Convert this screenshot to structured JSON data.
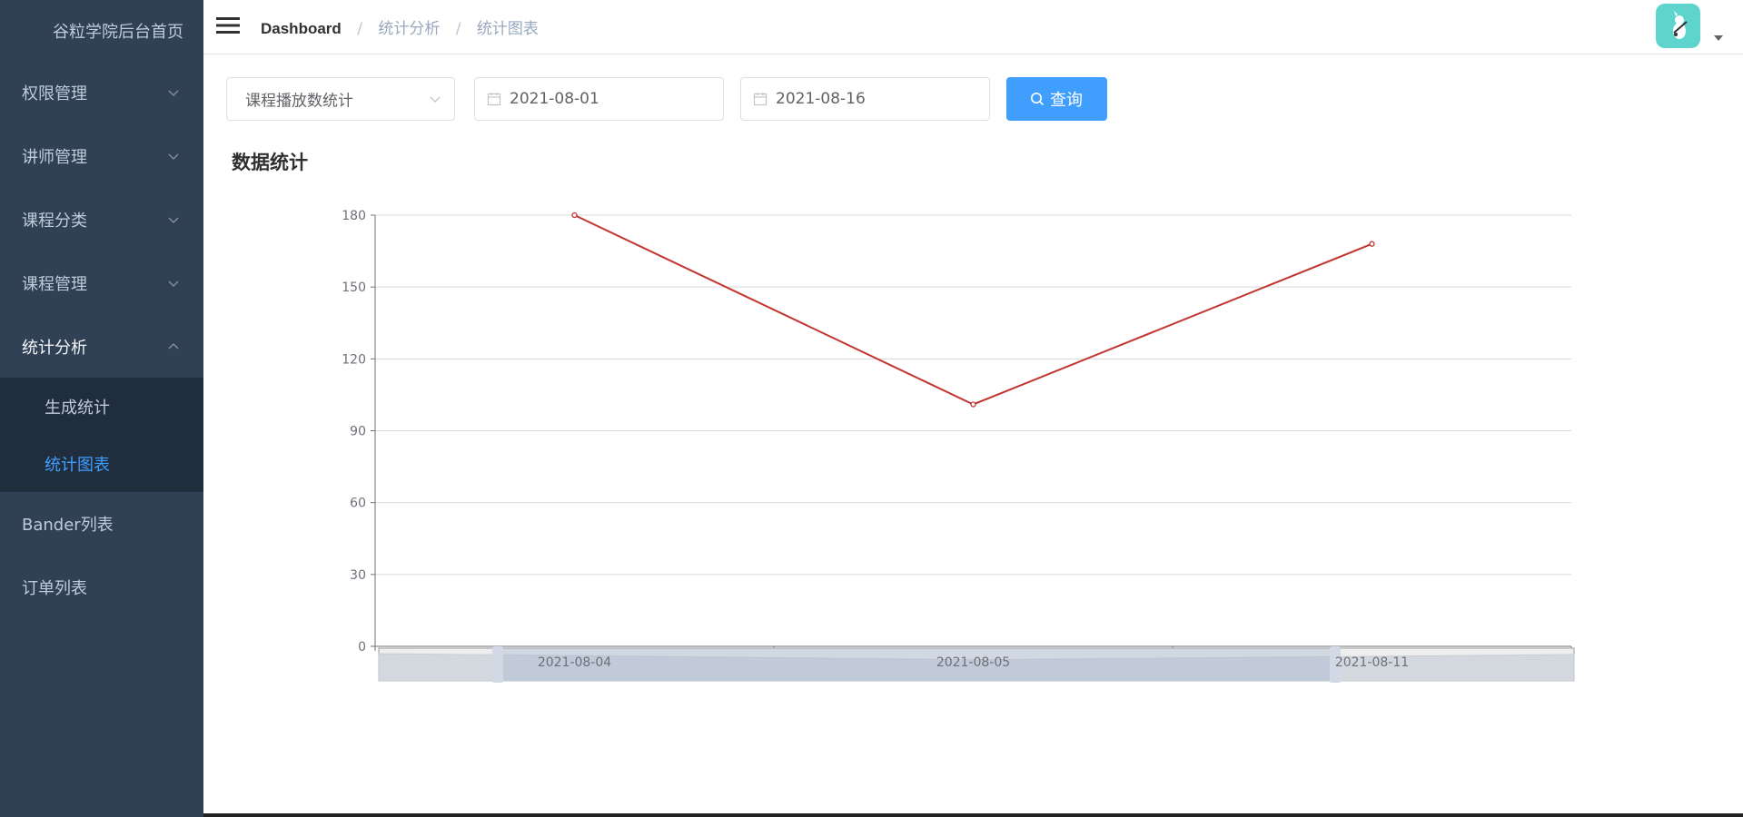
{
  "sidebar": {
    "title": "谷粒学院后台首页",
    "menu": [
      {
        "label": "权限管理"
      },
      {
        "label": "讲师管理"
      },
      {
        "label": "课程分类"
      },
      {
        "label": "课程管理"
      },
      {
        "label": "统计分析"
      }
    ],
    "submenu": [
      {
        "label": "生成统计"
      },
      {
        "label": "统计图表"
      }
    ],
    "bottom_items": [
      {
        "label": "Bander列表"
      },
      {
        "label": "订单列表"
      }
    ]
  },
  "navbar": {
    "breadcrumb": [
      "Dashboard",
      "统计分析",
      "统计图表"
    ]
  },
  "filters": {
    "type_select": "课程播放数统计",
    "begin_date": "2021-08-01",
    "end_date": "2021-08-16",
    "query_button": "查询"
  },
  "section_title": "数据统计",
  "colors": {
    "sidebar_bg": "#304156",
    "submenu_bg": "#1f2d3d",
    "accent": "#409eff",
    "line": "#c23531"
  },
  "chart_data": {
    "type": "line",
    "title": "",
    "xlabel": "",
    "ylabel": "",
    "categories": [
      "2021-08-04",
      "2021-08-05",
      "2021-08-11"
    ],
    "values": [
      180,
      101,
      168
    ],
    "ylim": [
      0,
      180
    ],
    "yticks": [
      0,
      30,
      60,
      90,
      120,
      150,
      180
    ],
    "grid": true,
    "has_datazoom_slider": true
  }
}
